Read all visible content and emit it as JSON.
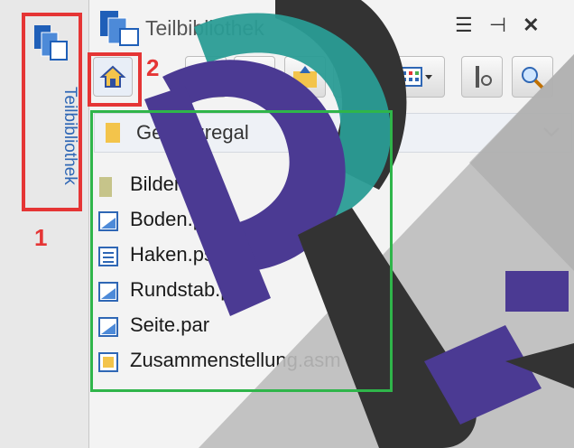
{
  "sidebar": {
    "tab_label": "Teilbibliothek"
  },
  "panel": {
    "title": "Teilbibliothek",
    "breadcrumb": "Gewürzregal",
    "items": [
      {
        "label": "Bilder",
        "icon": "folder-icon"
      },
      {
        "label": "Boden.par",
        "icon": "part-file-icon"
      },
      {
        "label": "Haken.psm",
        "icon": "sheetmetal-file-icon"
      },
      {
        "label": "Rundstab.par",
        "icon": "part-file-icon"
      },
      {
        "label": "Seite.par",
        "icon": "part-file-icon"
      },
      {
        "label": "Zusammenstellung.asm",
        "icon": "assembly-file-icon"
      }
    ]
  },
  "annotations": {
    "callout_1": "1",
    "callout_2": "2"
  },
  "colors": {
    "callout_red": "#e53535",
    "callout_green": "#2fb54a",
    "accent_blue": "#2f67b5",
    "watermark_purple": "#4b3a93",
    "watermark_teal": "#2a9c95",
    "watermark_dark": "#333333"
  }
}
